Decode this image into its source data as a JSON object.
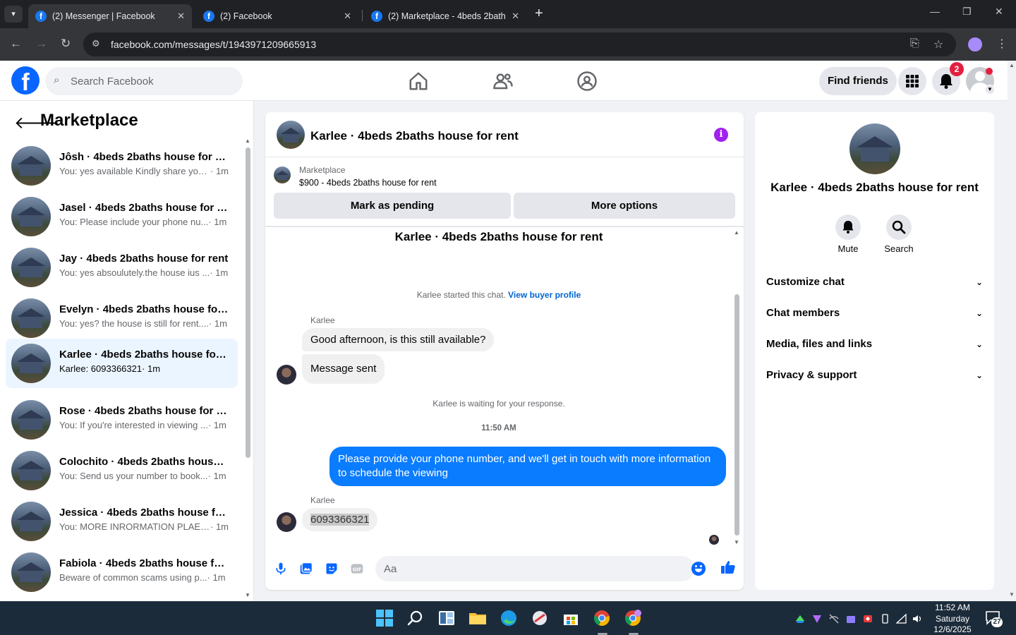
{
  "browser": {
    "tabs": [
      {
        "title": "(2) Messenger | Facebook",
        "active": true
      },
      {
        "title": "(2) Facebook",
        "active": false
      },
      {
        "title": "(2) Marketplace - 4beds 2baths",
        "active": false
      }
    ],
    "url": "facebook.com/messages/t/1943971209665913"
  },
  "fb_nav": {
    "search_placeholder": "Search Facebook",
    "find_friends": "Find friends",
    "notification_count": "2"
  },
  "sidebar": {
    "title": "Marketplace",
    "conversations": [
      {
        "name": "Jôsh · 4beds 2baths house for re...",
        "preview": "You: yes available Kindly share you...",
        "time": " · 1m",
        "selected": false
      },
      {
        "name": "Jasel · 4beds 2baths house for r...",
        "preview": "You: Please include your phone nu...",
        "time": " · 1m",
        "selected": false
      },
      {
        "name": "Jay · 4beds 2baths house for rent",
        "preview": "You: yes absoulutely.the house ius ...",
        "time": " · 1m",
        "selected": false
      },
      {
        "name": "Evelyn · 4beds 2baths house for ...",
        "preview": "You: yes? the house is still for rent....",
        "time": " · 1m",
        "selected": false
      },
      {
        "name": "Karlee · 4beds 2baths house for ...",
        "preview": "Karlee: 6093366321",
        "time": " · 1m",
        "selected": true
      },
      {
        "name": "Rose · 4beds 2baths house for r...",
        "preview": "You: If you're interested in viewing ...",
        "time": " · 1m",
        "selected": false
      },
      {
        "name": "Colochito · 4beds 2baths house ...",
        "preview": "You: Send us your number to book...",
        "time": " · 1m",
        "selected": false
      },
      {
        "name": "Jessica · 4beds 2baths house for...",
        "preview": "You: MORE INRORMATION PLAES ...",
        "time": " · 1m",
        "selected": false
      },
      {
        "name": "Fabiola · 4beds 2baths house for...",
        "preview": "Beware of common scams using p...",
        "time": " · 1m",
        "selected": false
      }
    ]
  },
  "chat": {
    "title": "Karlee · 4beds 2baths house for rent",
    "marketplace_label": "Marketplace",
    "listing": "$900 - 4beds 2baths house for rent",
    "mark_pending": "Mark as pending",
    "more_options": "More options",
    "thread_title": "Karlee · 4beds 2baths house for rent",
    "started_text": "Karlee started this chat.",
    "buyer_profile_link": "View buyer profile",
    "sender_name_1": "Karlee",
    "msg_in_1": "Good afternoon, is this still available?",
    "msg_in_2": "Message sent",
    "waiting_text": "Karlee is waiting for your response.",
    "timestamp": "11:50 AM",
    "msg_out_1": "Please provide your phone number, and we'll get in touch with more information to schedule the viewing",
    "sender_name_2": "Karlee",
    "msg_in_3": "6093366321",
    "composer_placeholder": "Aa"
  },
  "info_panel": {
    "name": "Karlee · 4beds 2baths house for rent",
    "mute": "Mute",
    "search": "Search",
    "sections": [
      "Customize chat",
      "Chat members",
      "Media, files and links",
      "Privacy & support"
    ]
  },
  "taskbar": {
    "time": "11:52 AM",
    "day": "Saturday",
    "date": "12/6/2025",
    "notification_count": "27"
  },
  "colors": {
    "brand_blue": "#0866ff",
    "outgoing_bubble": "#0a7cff",
    "selected_row": "#ebf5ff",
    "badge_red": "#e41e3f",
    "info_purple": "#a020f0"
  }
}
